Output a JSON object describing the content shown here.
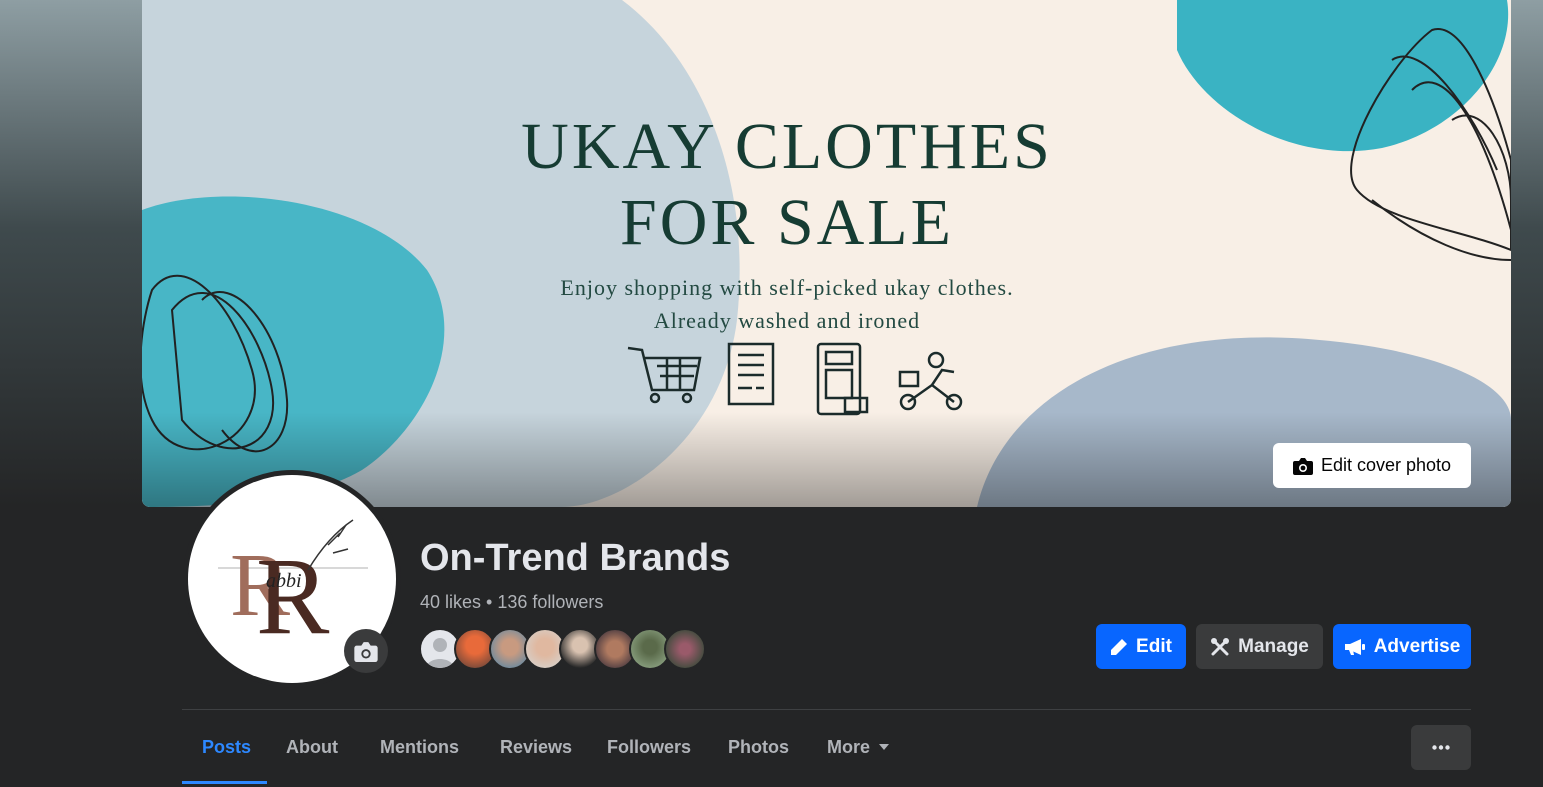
{
  "cover": {
    "title_line1": "UKAY CLOTHES",
    "title_line2": "FOR SALE",
    "subtitle_line1": "Enjoy shopping with self-picked ukay clothes.",
    "subtitle_line2": "Already washed and ironed",
    "icons": [
      "shopping-cart-icon",
      "receipt-icon",
      "pay-terminal-icon",
      "delivery-scooter-icon"
    ],
    "edit_label": "Edit cover photo",
    "edit_icon": "camera-icon"
  },
  "avatar": {
    "logo_text": "abbi",
    "camera_icon": "camera-icon"
  },
  "page": {
    "name": "On-Trend Brands",
    "stats": "40 likes • 136 followers"
  },
  "followers": {
    "count_shown": 8
  },
  "actions": {
    "edit_label": "Edit",
    "edit_icon": "pencil-icon",
    "manage_label": "Manage",
    "manage_icon": "tools-icon",
    "advertise_label": "Advertise",
    "advertise_icon": "megaphone-icon"
  },
  "tabs": [
    {
      "label": "Posts",
      "active": true
    },
    {
      "label": "About"
    },
    {
      "label": "Mentions"
    },
    {
      "label": "Reviews"
    },
    {
      "label": "Followers"
    },
    {
      "label": "Photos"
    },
    {
      "label": "More"
    }
  ],
  "more_menu_icon": "ellipsis-icon",
  "colors": {
    "background": "#242526",
    "primary": "#0866ff",
    "active_tab": "#2d88ff",
    "secondary_button": "#3a3b3c",
    "text": "#e4e6eb",
    "muted_text": "#b0b3b8",
    "cover_teal": "#3ab3c3",
    "cover_cream": "#f8efe6"
  }
}
